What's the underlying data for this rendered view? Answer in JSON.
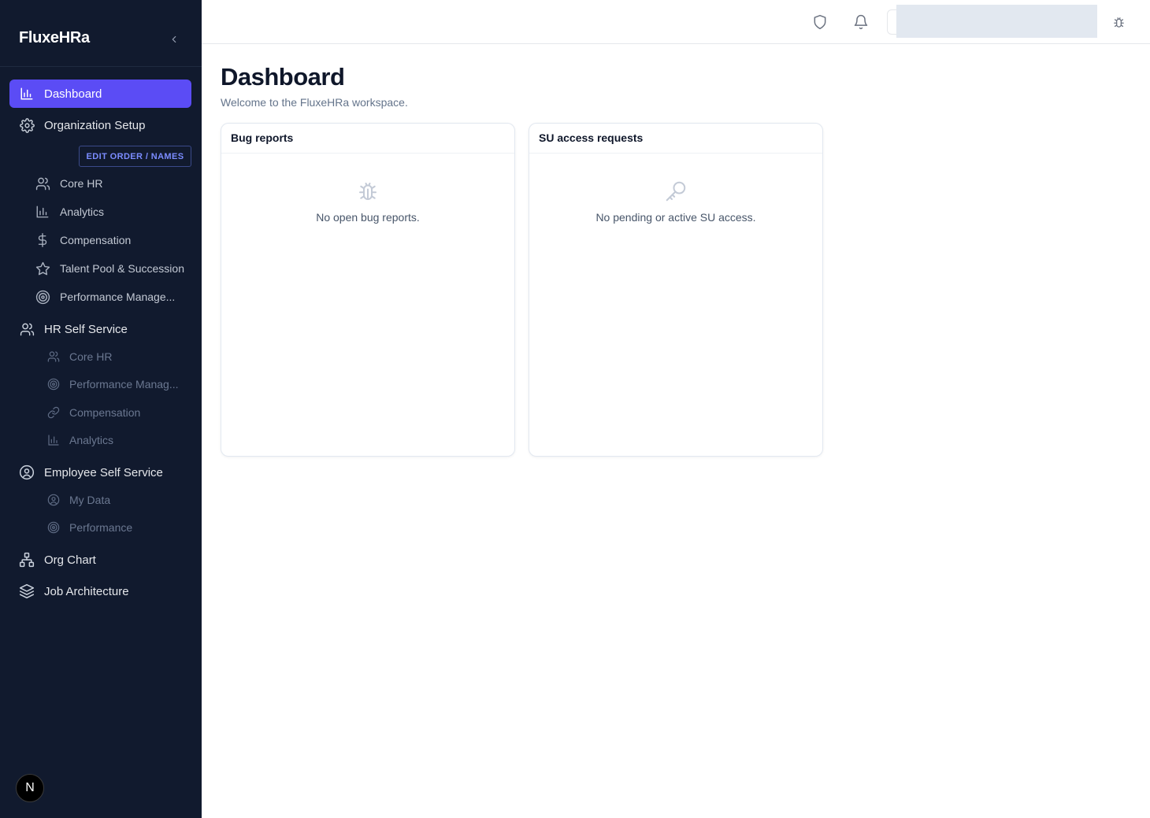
{
  "brand": "FluxeHRa",
  "sidebar": {
    "dashboard": "Dashboard",
    "org_setup": "Organization Setup",
    "edit_order": "EDIT ORDER / NAMES",
    "org_items": [
      {
        "label": "Core HR",
        "icon": "users-icon"
      },
      {
        "label": "Analytics",
        "icon": "bar-chart-icon"
      },
      {
        "label": "Compensation",
        "icon": "dollar-icon"
      },
      {
        "label": "Talent Pool & Succession",
        "icon": "star-icon"
      },
      {
        "label": "Performance Manage...",
        "icon": "target-icon"
      }
    ],
    "hr_self_service": "HR Self Service",
    "hr_items": [
      {
        "label": "Core HR",
        "icon": "users-icon"
      },
      {
        "label": "Performance Manag...",
        "icon": "target-icon"
      },
      {
        "label": "Compensation",
        "icon": "link-icon"
      },
      {
        "label": "Analytics",
        "icon": "bar-chart-icon"
      }
    ],
    "employee_self_service": "Employee Self Service",
    "ess_items": [
      {
        "label": "My Data",
        "icon": "user-circle-icon"
      },
      {
        "label": "Performance",
        "icon": "target-icon"
      }
    ],
    "org_chart": "Org Chart",
    "job_architecture": "Job Architecture",
    "avatar_letter": "N"
  },
  "main": {
    "title": "Dashboard",
    "subtitle": "Welcome to the FluxeHRa workspace.",
    "cards": [
      {
        "title": "Bug reports",
        "empty_text": "No open bug reports.",
        "icon": "bug-icon"
      },
      {
        "title": "SU access requests",
        "empty_text": "No pending or active SU access.",
        "icon": "key-icon"
      }
    ]
  },
  "colors": {
    "sidebar_bg": "#111a2e",
    "accent": "#5b4cf5",
    "edit_order_text": "#7b8cff"
  }
}
